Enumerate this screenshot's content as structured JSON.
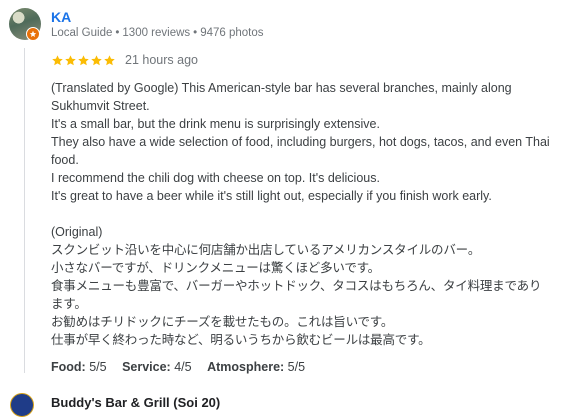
{
  "author": {
    "name": "KA",
    "role": "Local Guide",
    "reviews": "1300 reviews",
    "photos": "9476 photos",
    "separator": "•"
  },
  "review": {
    "rating": 5,
    "star_color": "#fbbc04",
    "time": "21 hours ago",
    "lines": [
      "(Translated by Google) This American-style bar has several branches, mainly along",
      "Sukhumvit Street.",
      "It's a small bar, but the drink menu is surprisingly extensive.",
      "They also have a wide selection of food, including burgers, hot dogs, tacos, and even Thai",
      "food.",
      "I recommend the chili dog with cheese on top. It's delicious.",
      "It's great to have a beer while it's still light out, especially if you finish work early.",
      "",
      "(Original)",
      "スクンビット沿いを中心に何店舗か出店しているアメリカンスタイルのバー。",
      "小さなバーですが、ドリンクメニューは驚くほど多いです。",
      "食事メニューも豊富で、バーガーやホットドック、タコスはもちろん、タイ料理まであり",
      "ます。",
      "お勧めはチリドックにチーズを載せたもの。これは旨いです。",
      "仕事が早く終わった時など、明るいうちから飲むビールは最高です。"
    ]
  },
  "ratings": {
    "food_label": "Food:",
    "food_value": "5/5",
    "service_label": "Service:",
    "service_value": "4/5",
    "atmosphere_label": "Atmosphere:",
    "atmosphere_value": "5/5"
  },
  "business": {
    "name": "Buddy's Bar & Grill (Soi 20)"
  },
  "colors": {
    "author_link": "#1a73e8",
    "local_guide_badge": "#e8710a"
  }
}
